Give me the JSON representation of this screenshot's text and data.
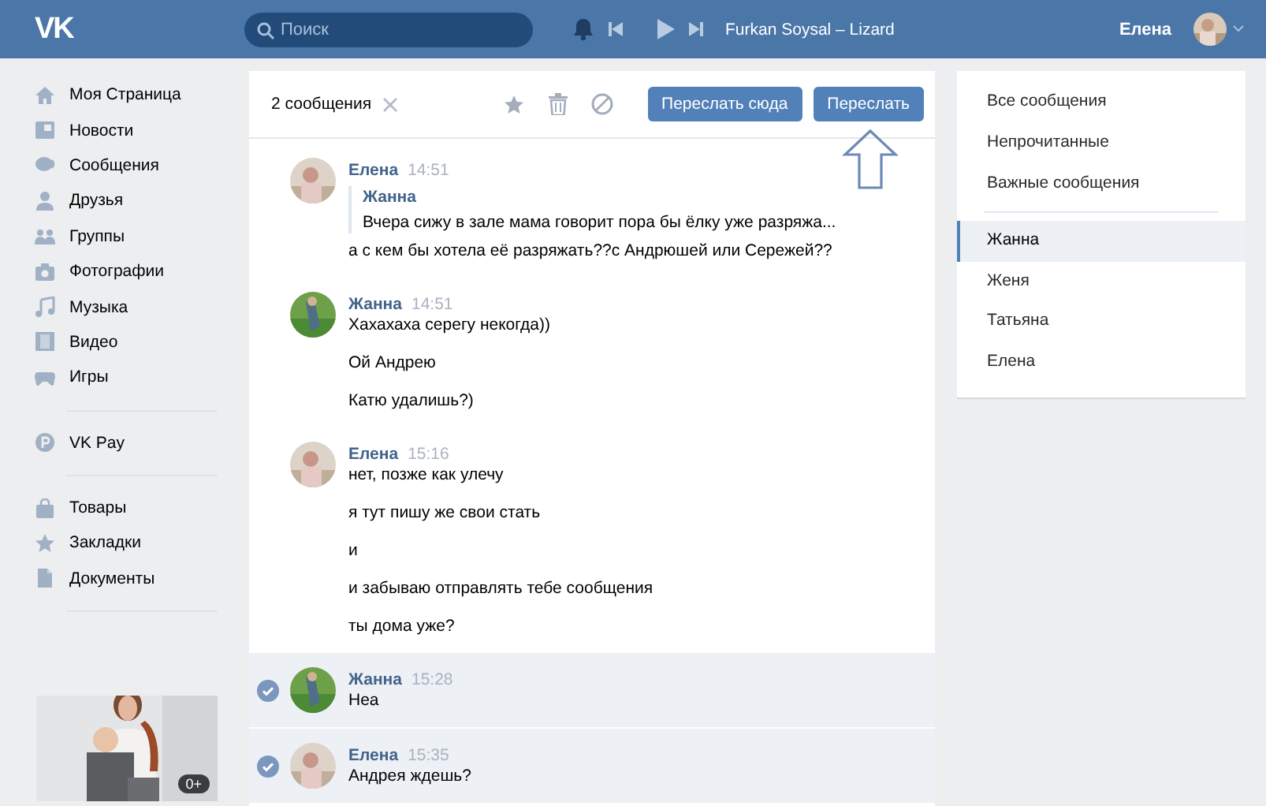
{
  "header": {
    "logo": "VK",
    "search": {
      "placeholder": "Поиск"
    },
    "track": "Furkan Soysal – Lizard",
    "user": "Елена"
  },
  "sidebar": {
    "groups": [
      [
        "Моя Страница",
        "Новости",
        "Сообщения",
        "Друзья",
        "Группы",
        "Фотографии",
        "Музыка",
        "Видео",
        "Игры"
      ],
      [
        "VK Pay"
      ],
      [
        "Товары",
        "Закладки",
        "Документы"
      ]
    ],
    "ad": {
      "kind": "picture",
      "badge": "0+"
    }
  },
  "chat": {
    "selection_count": "2 сообщения",
    "buttons": [
      "Переслать сюда",
      "Переслать"
    ],
    "messages": [
      {
        "author": "Елена",
        "time": "14:51",
        "selected": false,
        "forward": {
          "author": "Жанна",
          "text": "Вчера сижу в зале мама говорит пора бы ёлку уже разряжа..."
        },
        "lines": [
          "а с кем бы хотела её разряжать??с Андрюшей или Сережей??"
        ]
      },
      {
        "author": "Жанна",
        "time": "14:51",
        "selected": false,
        "lines": [
          "Хахахаха серегу некогда))",
          "Ой Андрею",
          "Катю удалишь?)"
        ]
      },
      {
        "author": "Елена",
        "time": "15:16",
        "selected": false,
        "lines": [
          "нет, позже как улечу",
          "я тут пишу же свои стать",
          "и",
          "и забываю отправлять тебе сообщения",
          "ты дома уже?"
        ]
      },
      {
        "author": "Жанна",
        "time": "15:28",
        "selected": true,
        "lines": [
          "Неа"
        ]
      },
      {
        "author": "Елена",
        "time": "15:35",
        "selected": true,
        "lines": [
          "Андрея ждешь?"
        ]
      }
    ]
  },
  "filters": [
    "Все сообщения",
    "Непрочитанные",
    "Важные сообщения"
  ],
  "conversations": [
    {
      "name": "Жанна",
      "selected": true
    },
    {
      "name": "Женя",
      "selected": false
    },
    {
      "name": "Татьяна",
      "selected": false
    },
    {
      "name": "Елена",
      "selected": false
    }
  ]
}
